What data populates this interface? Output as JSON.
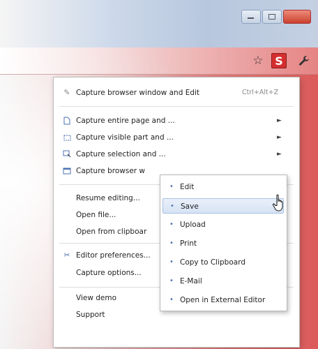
{
  "toolbar": {
    "s_label": "S"
  },
  "menu": {
    "items": [
      {
        "label": "Capture browser window and Edit",
        "shortcut": "Ctrl+Alt+Z",
        "icon": "pen-icon"
      },
      {
        "label": "Capture entire page and ...",
        "icon": "page-icon",
        "submenu": true
      },
      {
        "label": "Capture visible part and ...",
        "icon": "visible-part-icon",
        "submenu": true
      },
      {
        "label": "Capture selection and ...",
        "icon": "selection-icon",
        "submenu": true
      },
      {
        "label": "Capture browser w",
        "icon": "window-icon"
      },
      {
        "label": "Resume editing..."
      },
      {
        "label": "Open file..."
      },
      {
        "label": "Open from clipboar"
      },
      {
        "label": "Editor preferences...",
        "icon": "preferences-icon"
      },
      {
        "label": "Capture options..."
      },
      {
        "label": "View demo"
      },
      {
        "label": "Support"
      }
    ]
  },
  "submenu": {
    "items": [
      {
        "label": "Edit"
      },
      {
        "label": "Save",
        "highlighted": true
      },
      {
        "label": "Upload"
      },
      {
        "label": "Print"
      },
      {
        "label": "Copy to Clipboard"
      },
      {
        "label": "E-Mail"
      },
      {
        "label": "Open in External Editor"
      }
    ]
  }
}
